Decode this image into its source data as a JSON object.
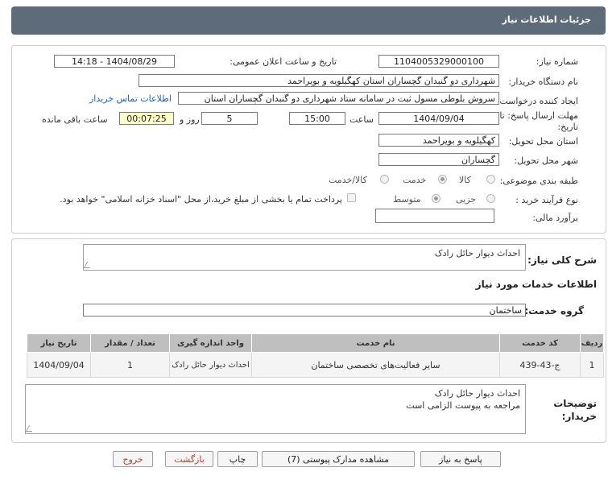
{
  "header": {
    "title": "جزئیات اطلاعات نیاز"
  },
  "need": {
    "number_label": "شماره نیاز:",
    "number_value": "1104005329000100",
    "announce_label": "تاریخ و ساعت اعلان عمومی:",
    "announce_value": "1404/08/29 - 14:18",
    "buyer_label": "نام دستگاه خریدار:",
    "buyer_value": "شهرداری دو گنبدان گچساران استان کهگیلویه و بویراحمد",
    "creator_label": "ایجاد کننده درخواست:",
    "creator_value": "سروش بلوطی مسول ثبت در سامانه ستاد شهرداری دو گنبدان گچساران استان",
    "contact_link": "اطلاعات تماس خریدار",
    "deadline_label": "مهلت ارسال پاسخ: تا تاریخ:",
    "deadline_date": "1404/09/04",
    "time_label": "ساعت",
    "deadline_time": "15:00",
    "days_value": "5",
    "days_label": "روز و",
    "remaining_value": "00:07:25",
    "remaining_label": "ساعت باقی مانده",
    "province_label": "استان محل تحویل:",
    "province_value": "کهگیلویه و بویراحمد",
    "city_label": "شهر محل تحویل:",
    "city_value": "گچساران",
    "category_label": "طبقه بندی موضوعی:",
    "category_options": [
      "کالا",
      "خدمت",
      "کالا/خدمت"
    ],
    "category_selected": "خدمت",
    "process_label": "نوع فرآیند خرید :",
    "process_options": [
      "جزیی",
      "متوسط"
    ],
    "process_selected": "متوسط",
    "payment_note": "پرداخت تمام یا بخشی از مبلغ خرید،از محل \"اسناد خزانه اسلامی\" خواهد بود.",
    "estimate_label": "برآورد مالی:",
    "estimate_value": ""
  },
  "summary": {
    "label": "شرح کلی نیاز:",
    "value": "احداث دیوار حائل رادک"
  },
  "services": {
    "section_title": "اطلاعات خدمات مورد نیاز",
    "group_label": "گروه خدمت:",
    "group_value": "ساختمان",
    "columns": [
      "ردیف",
      "کد خدمت",
      "نام خدمت",
      "واحد اندازه گیری",
      "تعداد / مقدار",
      "تاریخ نیاز"
    ],
    "rows": [
      {
        "index": "1",
        "code": "ج-43-439",
        "name": "سایر فعالیت‌های تخصصی ساختمان",
        "unit": "احداث دیوار حائل رادک",
        "qty": "1",
        "date": "1404/09/04"
      }
    ]
  },
  "notes": {
    "label_1": "توضیحات",
    "label_2": "خریدار:",
    "line_1": "احداث دیوار حائل رادک",
    "line_2": "مراجعه به پیوست الزامی است"
  },
  "buttons": {
    "reply": "پاسخ به نیاز",
    "attachments": "مشاهده مدارک پیوستی (7)",
    "print": "چاپ",
    "back": "بازگشت",
    "exit": "خروج"
  },
  "colors": {
    "header_bg": "#5e6b78",
    "link": "#1a63c7",
    "remaining_bg": "#ffffcc",
    "table_header": "#bfbfbf"
  }
}
